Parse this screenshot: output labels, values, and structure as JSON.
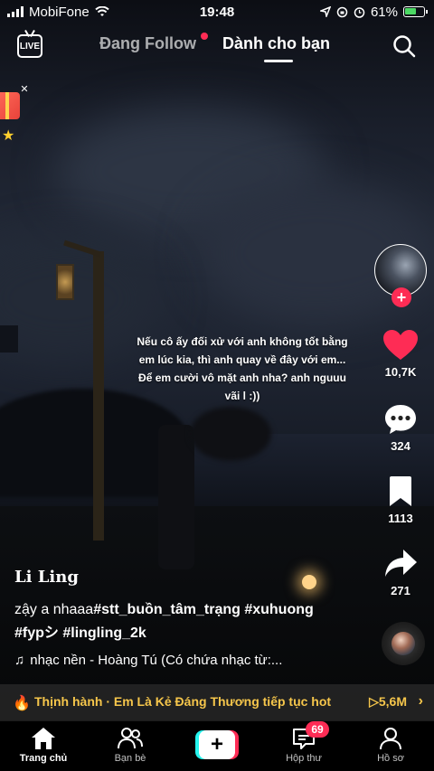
{
  "status_bar": {
    "carrier": "MobiFone",
    "time": "19:48",
    "battery_percent": "61%",
    "battery_level": 0.61
  },
  "top_nav": {
    "live_label": "LIVE",
    "following_tab": "Đang Follow",
    "for_you_tab": "Dành cho bạn"
  },
  "video": {
    "overlay_text": "Nếu cô ấy đối xử với anh không tốt bằng em lúc kia, thì anh quay về đây với em... Để em cười vô mặt anh nha? anh nguuu vãi l :))",
    "author": "Li Ling",
    "caption_plain": "zậy a nhaaa",
    "caption_tags_line1": "#stt_buồn_tâm_trạng #xuhuong",
    "caption_tags_line2": "#fypシ #lingling_2k",
    "sound": "nhạc nền - Hoàng Tú (Có chứa nhạc từ:..."
  },
  "actions": {
    "likes": "10,7K",
    "comments": "324",
    "bookmarks": "1113",
    "shares": "271"
  },
  "trending": {
    "text": "Thịnh hành · Em Là Kẻ Đáng Thương tiếp tục hot",
    "views": "5,6M"
  },
  "bottom_nav": {
    "home": "Trang chủ",
    "friends": "Bạn bè",
    "inbox": "Hộp thư",
    "inbox_badge": "69",
    "profile": "Hồ sơ"
  },
  "colors": {
    "accent": "#fe2c55",
    "trending": "#f6c64b",
    "create_cyan": "#25f4ee"
  }
}
